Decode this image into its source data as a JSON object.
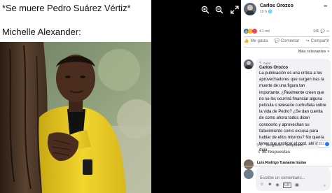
{
  "meme": {
    "caption_top": "*Se muere Pedro Suárez Vértiz*",
    "caption_bottom": "Michelle Alexander:"
  },
  "viewer": {
    "zoom_in_icon": "zoom-in-icon",
    "zoom_out_icon": "zoom-out-icon",
    "expand_icon": "expand-icon"
  },
  "post": {
    "author": "Carlos Orozco",
    "time": "10 h",
    "audience_icon": "globe-icon",
    "reactions_count": "4,1 mil",
    "comments_count": "946",
    "actions": {
      "like": "Me gusta",
      "comment": "Comentar",
      "share": "Compartir"
    },
    "sort_label": "Más relevantes"
  },
  "comment": {
    "badge": "Autor",
    "author": "Carlos Orozco",
    "text": "La publicación es una crítica a los aprovechadores que surgen tras la muerte de una figura tan importante. ¿Realmente creen que no se les ocurrirá financiar alguna película o teleserie cuchufleta sobre la vida de Pedro? ¿Se dan cuenta de como ahora todos dicen conocerlo y aprovechan su fallecimiento como excusa para hablar de ellos mismos? No quería tener que explicar el post, ahí la dejo...",
    "time": "9 h",
    "like": "Me gusta",
    "reply": "Responder",
    "reactions_count": "553",
    "replies_link": "92 respuestas"
  },
  "next_comment": {
    "author": "Luis Rodrigo Tuanama Inuma"
  },
  "composer": {
    "placeholder": "Escribe un comentario..."
  },
  "colors": {
    "facebook_blue": "#1877f2",
    "meme_jacket": "#e8c623",
    "panel_bg": "#ffffff"
  }
}
